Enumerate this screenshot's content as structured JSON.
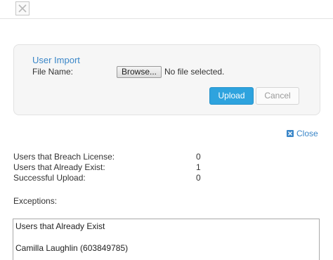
{
  "dialog": {
    "close_icon": "close-x-icon"
  },
  "import_panel": {
    "title": "User Import",
    "file_label": "File Name:",
    "browse_label": "Browse...",
    "file_status": "No file selected.",
    "upload_label": "Upload",
    "cancel_label": "Cancel"
  },
  "close_link": {
    "icon": "close-square-icon",
    "label": "Close"
  },
  "stats": [
    {
      "label": "Users that Breach License:",
      "value": "0"
    },
    {
      "label": "Users that Already Exist:",
      "value": "1"
    },
    {
      "label": "Successful Upload:",
      "value": "0"
    }
  ],
  "exceptions": {
    "label": "Exceptions:",
    "title": "Users that Already Exist",
    "entries": [
      "Camilla Laughlin (603849785)"
    ]
  },
  "colors": {
    "accent": "#3a86c8",
    "upload_button": "#2ea3de"
  }
}
